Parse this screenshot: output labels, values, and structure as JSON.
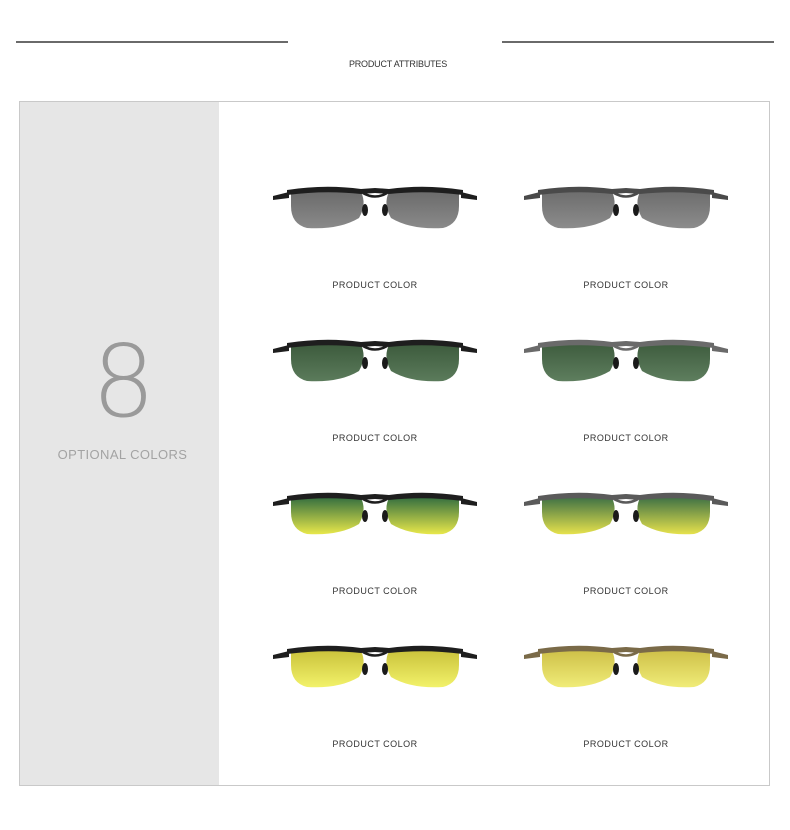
{
  "header": {
    "title": "PRODUCT ATTRIBUTES"
  },
  "summary": {
    "count": "8",
    "label": "OPTIONAL COLORS"
  },
  "products": [
    {
      "label": "PRODUCT COLOR",
      "frame": "#1e1e1e",
      "lens_top": "#6a6a6a",
      "lens_bottom": "#8a8a8a"
    },
    {
      "label": "PRODUCT COLOR",
      "frame": "#4a4a4a",
      "lens_top": "#6c6c6c",
      "lens_bottom": "#8c8c8c"
    },
    {
      "label": "PRODUCT COLOR",
      "frame": "#1e1e1e",
      "lens_top": "#3c5a3c",
      "lens_bottom": "#5b7b5b"
    },
    {
      "label": "PRODUCT COLOR",
      "frame": "#6a6a6a",
      "lens_top": "#3e5c3e",
      "lens_bottom": "#5e7e5e"
    },
    {
      "label": "PRODUCT COLOR",
      "frame": "#1e1e1e",
      "lens_top": "#2f6b3f",
      "lens_bottom": "#e8e84a"
    },
    {
      "label": "PRODUCT COLOR",
      "frame": "#5a5a5a",
      "lens_top": "#3a6e45",
      "lens_bottom": "#e6e24c"
    },
    {
      "label": "PRODUCT COLOR",
      "frame": "#1e1e1e",
      "lens_top": "#c9c13a",
      "lens_bottom": "#f2f26a"
    },
    {
      "label": "PRODUCT COLOR",
      "frame": "#7a6a48",
      "lens_top": "#cdbf47",
      "lens_bottom": "#f0ec78"
    }
  ]
}
